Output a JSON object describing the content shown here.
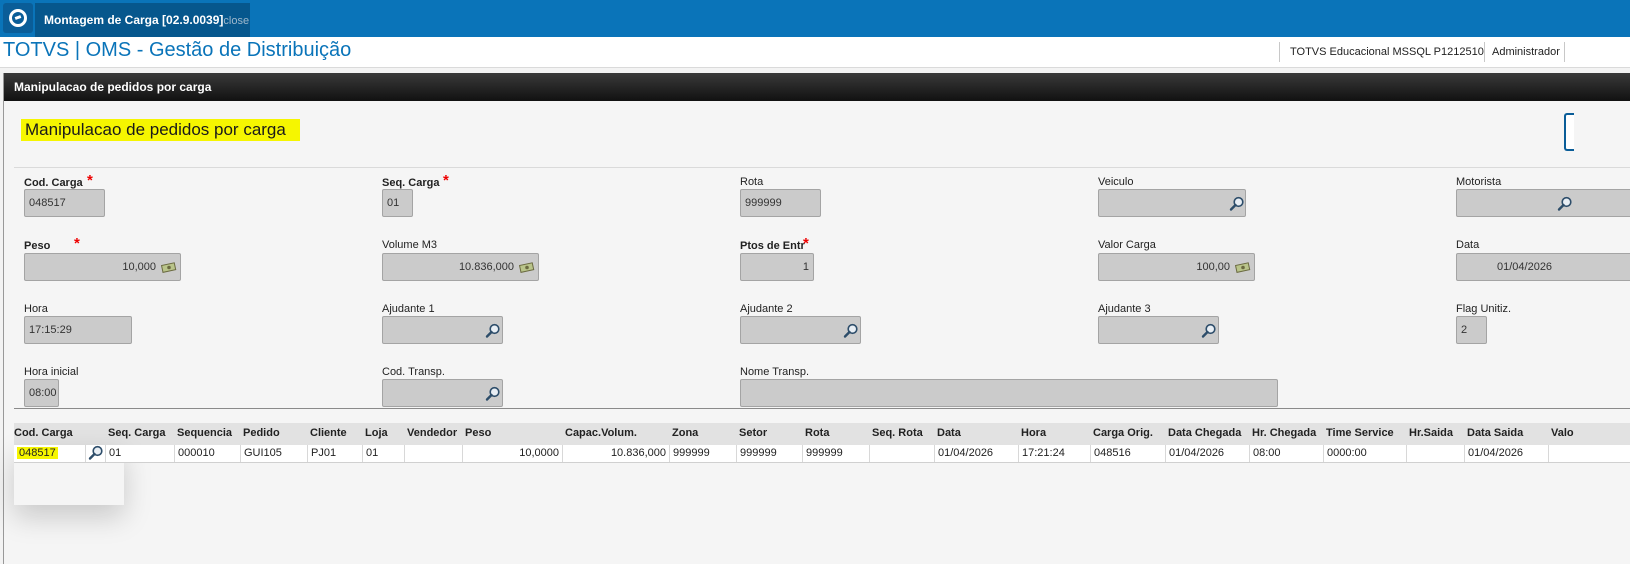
{
  "window": {
    "tab_title": "Montagem de Carga [02.9.0039]",
    "tab_close": "close"
  },
  "header": {
    "app_title": "TOTVS | OMS - Gestão de Distribuição",
    "environment": "TOTVS Educacional MSSQL P1212510",
    "user": "Administrador"
  },
  "panel": {
    "title": "Manipulacao de pedidos por carga",
    "heading": "Manipulacao de pedidos por carga"
  },
  "form": {
    "cod_carga": {
      "label": "Cod. Carga",
      "value": "048517"
    },
    "seq_carga": {
      "label": "Seq. Carga",
      "value": "01"
    },
    "rota": {
      "label": "Rota",
      "value": "999999"
    },
    "veiculo": {
      "label": "Veiculo",
      "value": ""
    },
    "motorista": {
      "label": "Motorista",
      "value": ""
    },
    "peso": {
      "label": "Peso",
      "value": "10,000"
    },
    "volume_m3": {
      "label": "Volume M3",
      "value": "10.836,000"
    },
    "ptos_entr": {
      "label": "Ptos de Entr",
      "value": "1"
    },
    "valor_carga": {
      "label": "Valor Carga",
      "value": "100,00"
    },
    "data": {
      "label": "Data",
      "value": "01/04/2026"
    },
    "hora": {
      "label": "Hora",
      "value": "17:15:29"
    },
    "ajudante1": {
      "label": "Ajudante 1",
      "value": ""
    },
    "ajudante2": {
      "label": "Ajudante 2",
      "value": ""
    },
    "ajudante3": {
      "label": "Ajudante 3",
      "value": ""
    },
    "flag_unitiz": {
      "label": "Flag Unitiz.",
      "value": "2"
    },
    "hora_inicial": {
      "label": "Hora inicial",
      "value": "08:00"
    },
    "cod_transp": {
      "label": "Cod. Transp.",
      "value": ""
    },
    "nome_transp": {
      "label": "Nome Transp.",
      "value": ""
    },
    "required_mark": "*"
  },
  "grid": {
    "columns": [
      "Cod. Carga",
      "Seq. Carga",
      "Sequencia",
      "Pedido",
      "Cliente",
      "Loja",
      "Vendedor",
      "Peso",
      "Capac.Volum.",
      "Zona",
      "Setor",
      "Rota",
      "Seq. Rota",
      "Data",
      "Hora",
      "Carga Orig.",
      "Data Chegada",
      "Hr. Chegada",
      "Time Service",
      "Hr.Saida",
      "Data Saida",
      "Valo"
    ],
    "rows": [
      [
        "048517",
        "01",
        "000010",
        "GUI105",
        "PJ01",
        "01",
        "",
        "10,0000",
        "10.836,000",
        "999999",
        "999999",
        "999999",
        "",
        "01/04/2026",
        "17:21:24",
        "048516",
        "01/04/2026",
        "08:00",
        "0000:00",
        "",
        "01/04/2026",
        ""
      ]
    ]
  },
  "icons": {
    "lookup": "magnifier-icon",
    "calculator": "cash-icon",
    "app_logo": "totvs-logo-icon"
  },
  "colors": {
    "topbar": "#0a74b9",
    "highlight": "#f6f600",
    "required": "#e00000"
  }
}
